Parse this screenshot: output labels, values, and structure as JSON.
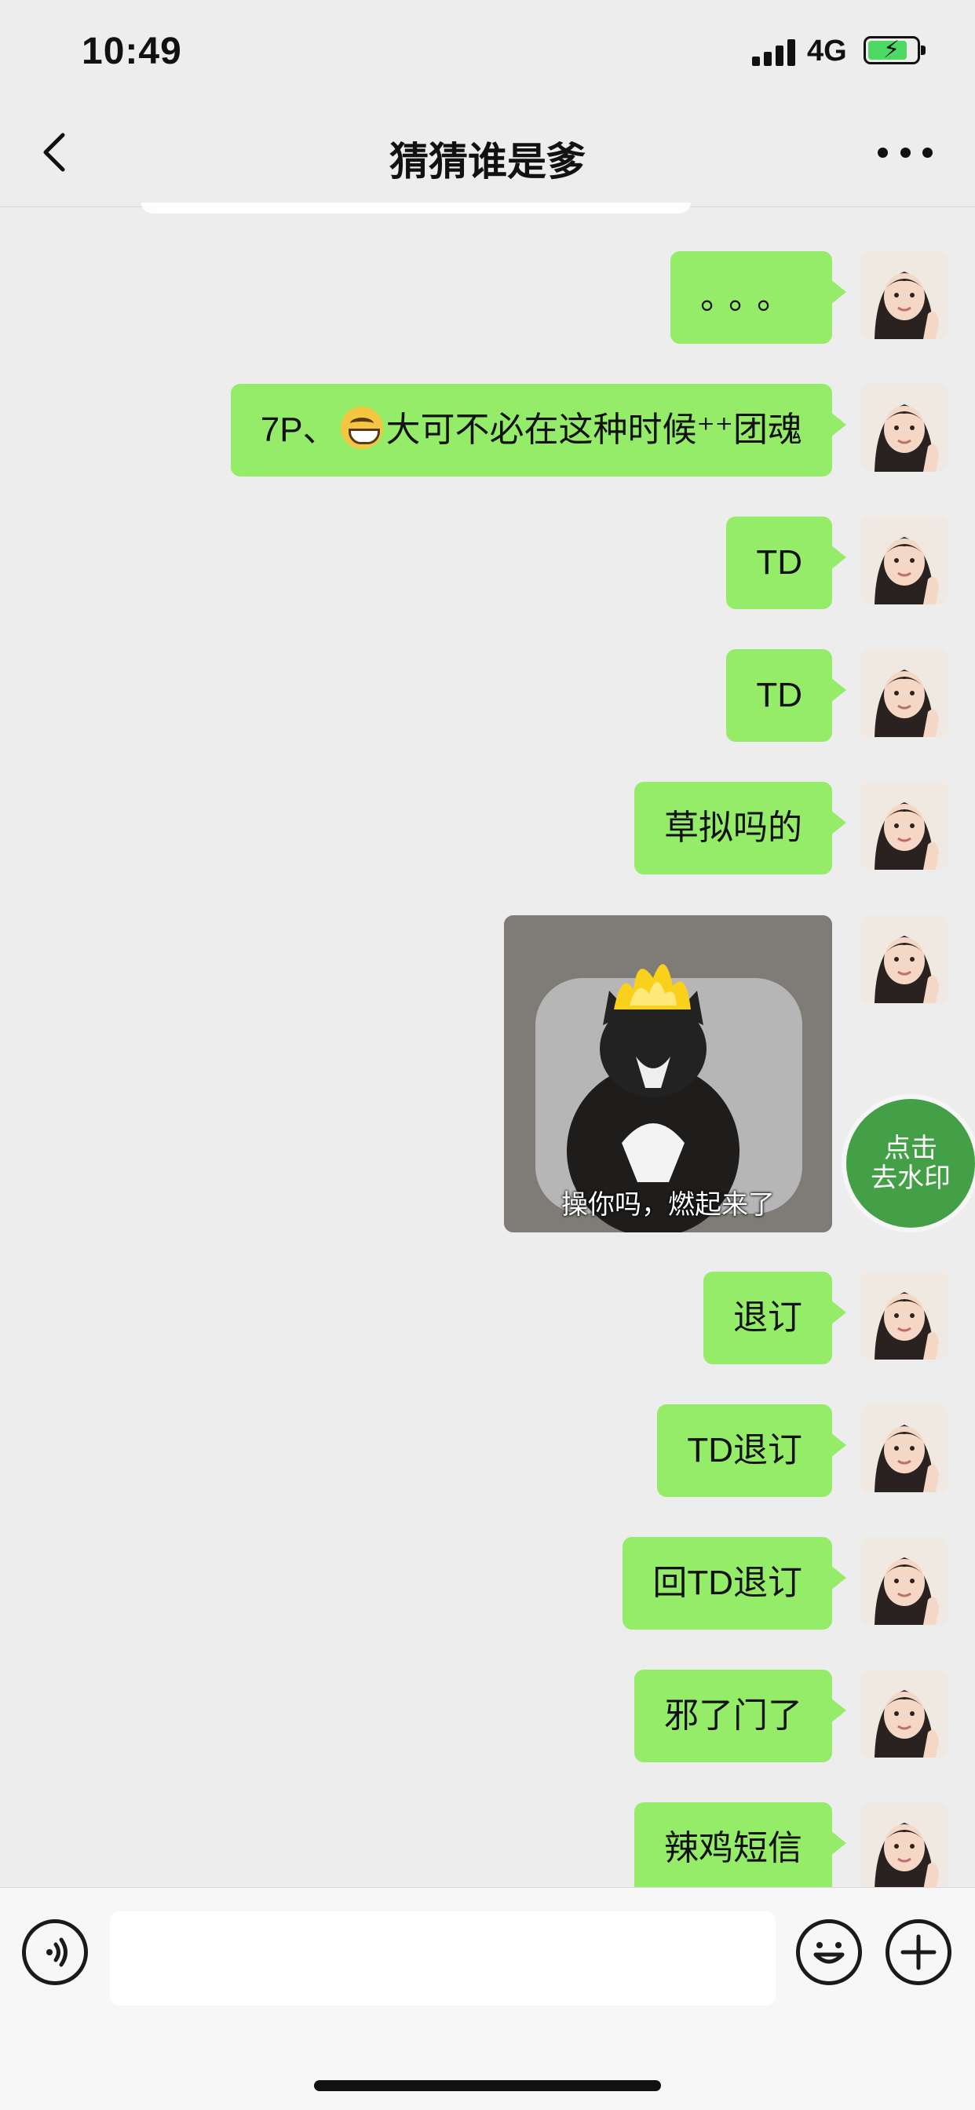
{
  "status_bar": {
    "time": "10:49",
    "network": "4G"
  },
  "nav": {
    "title": "猜猜谁是爹"
  },
  "messages": [
    {
      "text": "。。。"
    },
    {
      "text_before": "7P、",
      "text_after": "大可不必在这种时候⁺⁺团魂"
    },
    {
      "text": "TD"
    },
    {
      "text": "TD"
    },
    {
      "text": "草拟吗的"
    },
    {
      "sticker_caption": "操你吗，燃起来了"
    },
    {
      "text": "退订"
    },
    {
      "text": "TD退订"
    },
    {
      "text": "回TD退订"
    },
    {
      "text": "邪了门了"
    },
    {
      "text": "辣鸡短信"
    }
  ],
  "watermark_badge": {
    "line1": "点击",
    "line2": "去水印"
  },
  "input": {
    "placeholder": ""
  },
  "colors": {
    "bubble": "#95ec69",
    "background": "#ededed",
    "badge": "#43a047"
  }
}
